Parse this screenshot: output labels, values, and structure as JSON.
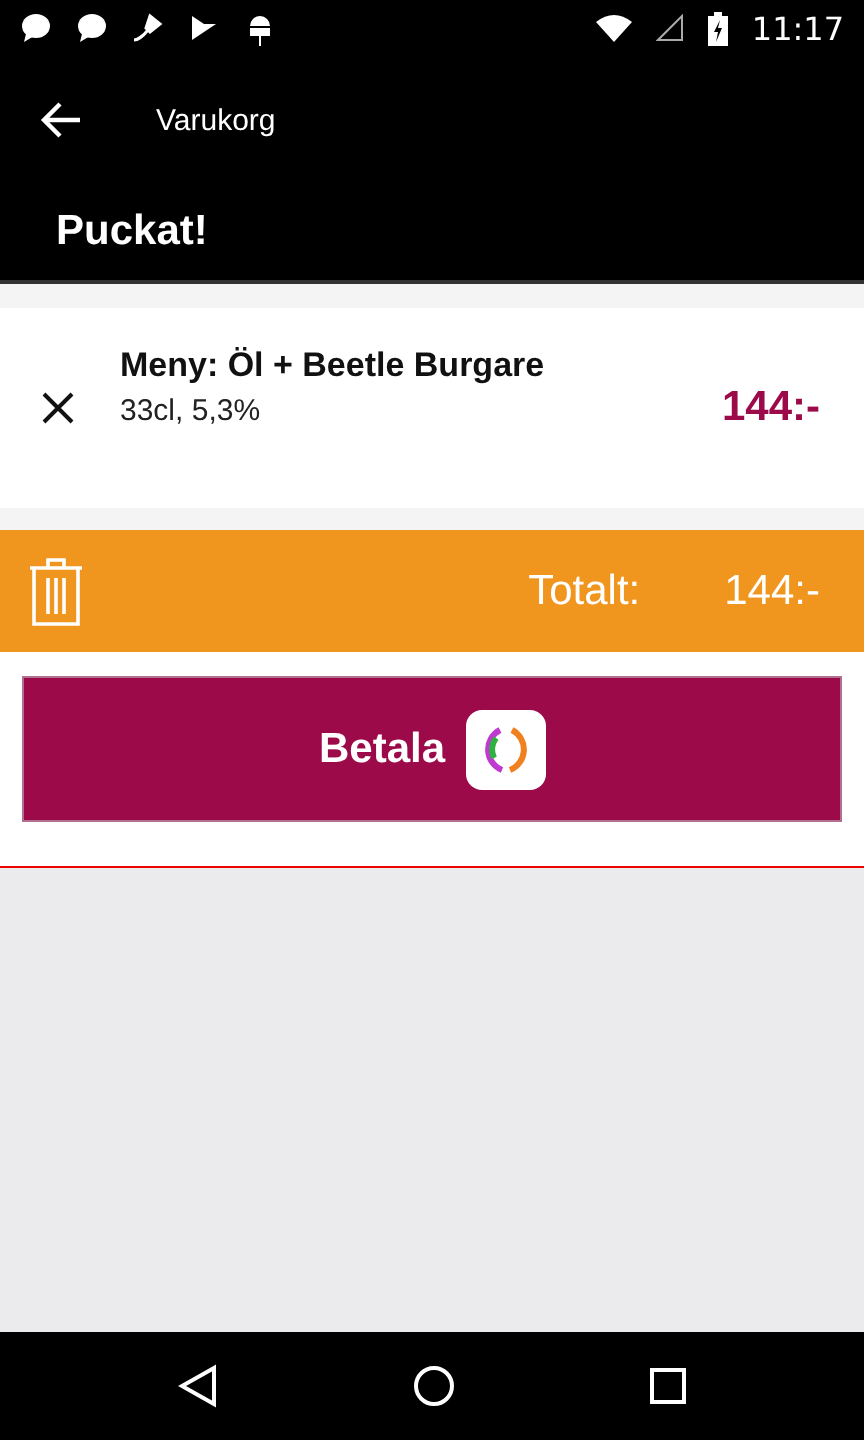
{
  "status_bar": {
    "time": "11:17"
  },
  "toolbar": {
    "title": "Varukorg"
  },
  "header": {
    "title": "Puckat!"
  },
  "cart_items": [
    {
      "name": "Meny: Öl + Beetle Burgare",
      "details": "33cl, 5,3%",
      "price": "144:-"
    }
  ],
  "total_bar": {
    "label": "Totalt:",
    "amount": "144:-"
  },
  "pay_button": {
    "label": "Betala"
  }
}
